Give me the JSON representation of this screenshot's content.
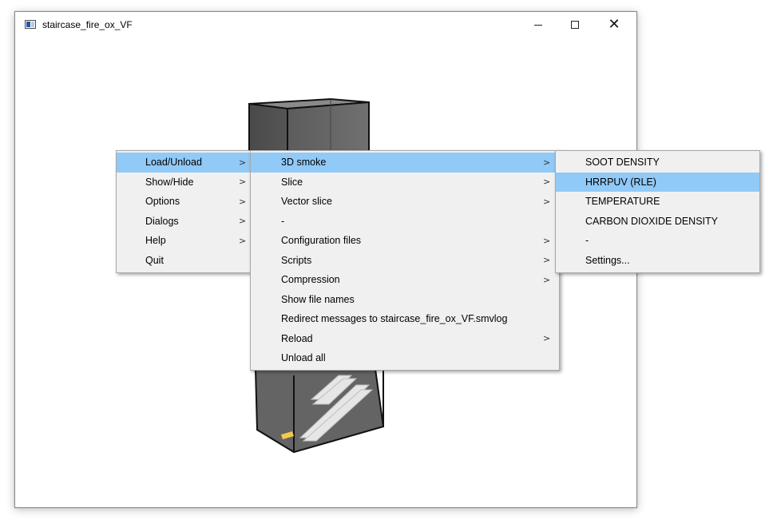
{
  "window": {
    "title": "staircase_fire_ox_VF",
    "minimize_glyph": "minimize-icon",
    "maximize_glyph": "maximize-icon",
    "close_label": "✕"
  },
  "menus": {
    "main": {
      "items": [
        {
          "label": "Load/Unload",
          "arrow": ">",
          "highlighted": true
        },
        {
          "label": "Show/Hide",
          "arrow": ">"
        },
        {
          "label": "Options",
          "arrow": ">"
        },
        {
          "label": "Dialogs",
          "arrow": ">"
        },
        {
          "label": "Help",
          "arrow": ">"
        },
        {
          "label": "Quit",
          "arrow": ""
        }
      ]
    },
    "load_unload": {
      "items": [
        {
          "label": "3D smoke",
          "arrow": ">",
          "highlighted": true
        },
        {
          "label": "Slice",
          "arrow": ">"
        },
        {
          "label": "Vector slice",
          "arrow": ">"
        },
        {
          "label": "-",
          "arrow": ""
        },
        {
          "label": "Configuration files",
          "arrow": ">"
        },
        {
          "label": "Scripts",
          "arrow": ">"
        },
        {
          "label": "Compression",
          "arrow": ">"
        },
        {
          "label": "Show file names",
          "arrow": ""
        },
        {
          "label": "Redirect messages to staircase_fire_ox_VF.smvlog",
          "arrow": ""
        },
        {
          "label": "Reload",
          "arrow": ">"
        },
        {
          "label": "Unload all",
          "arrow": ""
        }
      ]
    },
    "smoke3d": {
      "items": [
        {
          "label": "SOOT DENSITY"
        },
        {
          "label": "HRRPUV (RLE)",
          "highlighted": true
        },
        {
          "label": "TEMPERATURE"
        },
        {
          "label": "CARBON DIOXIDE DENSITY"
        },
        {
          "label": "-"
        },
        {
          "label": "Settings..."
        }
      ]
    }
  },
  "colors": {
    "menu_bg": "#f0f0f0",
    "highlight": "#91c9f7",
    "box_fill": "#6a6a6a",
    "fire": "#f2c94c"
  }
}
